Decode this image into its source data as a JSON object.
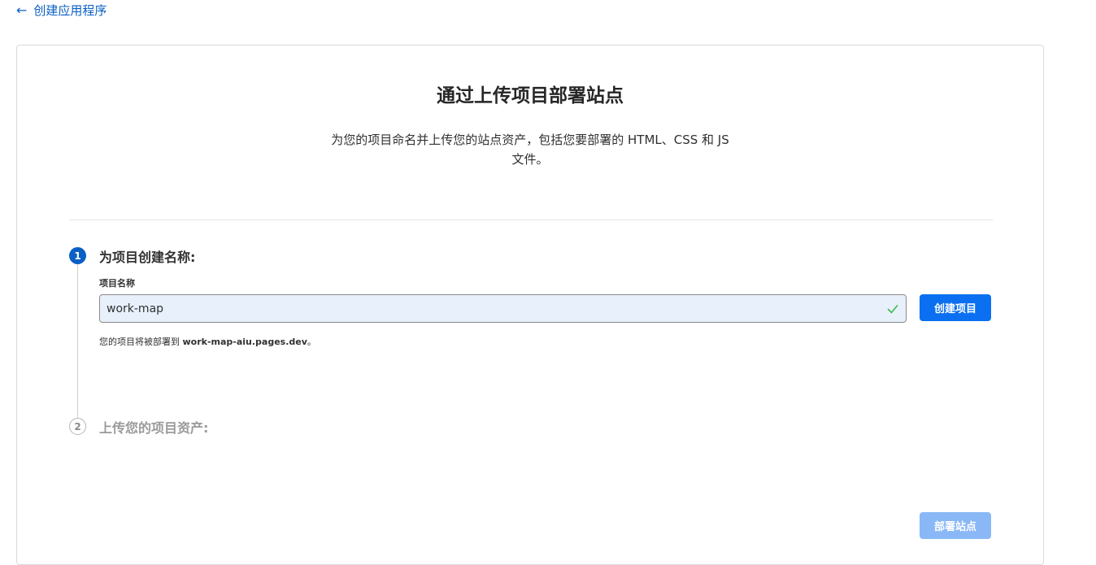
{
  "nav": {
    "back_label": "创建应用程序",
    "back_icon": "arrow-left-icon"
  },
  "header": {
    "title": "通过上传项目部署站点",
    "subtitle_line1": "为您的项目命名并上传您的站点资产，包括您要部署的 HTML、CSS 和 JS",
    "subtitle_line2": "文件。"
  },
  "steps": [
    {
      "number": "1",
      "title": "为项目创建名称:",
      "field_label": "项目名称",
      "input_value": "work-map",
      "button_label": "创建项目",
      "hint_prefix": "您的项目将被部署到 ",
      "hint_domain": "work-map-aiu.pages.dev",
      "hint_suffix": "。"
    },
    {
      "number": "2",
      "title": "上传您的项目资产:"
    }
  ],
  "footer": {
    "deploy_label": "部署站点"
  },
  "colors": {
    "accent": "#0a5fc4",
    "button": "#0a6ff0",
    "button_disabled": "#8ab8f6",
    "input_bg": "#e8f0fb",
    "valid": "#3fb950"
  }
}
